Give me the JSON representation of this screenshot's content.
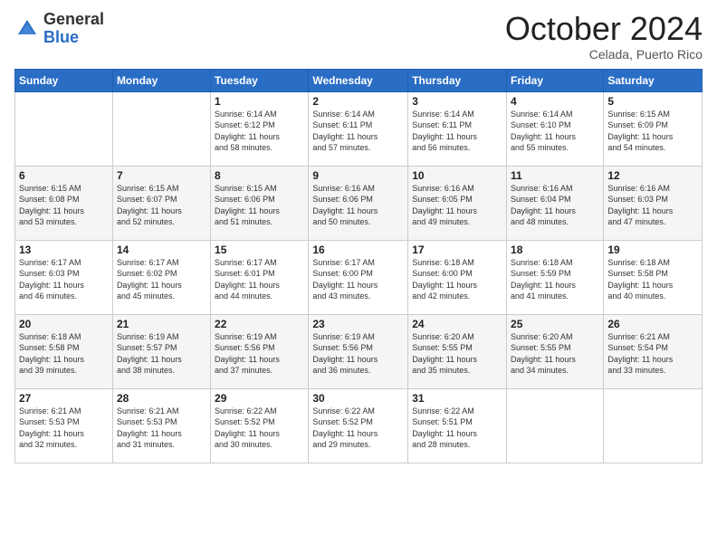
{
  "logo": {
    "general": "General",
    "blue": "Blue"
  },
  "header": {
    "month": "October 2024",
    "location": "Celada, Puerto Rico"
  },
  "weekdays": [
    "Sunday",
    "Monday",
    "Tuesday",
    "Wednesday",
    "Thursday",
    "Friday",
    "Saturday"
  ],
  "weeks": [
    [
      {
        "day": "",
        "info": ""
      },
      {
        "day": "",
        "info": ""
      },
      {
        "day": "1",
        "info": "Sunrise: 6:14 AM\nSunset: 6:12 PM\nDaylight: 11 hours\nand 58 minutes."
      },
      {
        "day": "2",
        "info": "Sunrise: 6:14 AM\nSunset: 6:11 PM\nDaylight: 11 hours\nand 57 minutes."
      },
      {
        "day": "3",
        "info": "Sunrise: 6:14 AM\nSunset: 6:11 PM\nDaylight: 11 hours\nand 56 minutes."
      },
      {
        "day": "4",
        "info": "Sunrise: 6:14 AM\nSunset: 6:10 PM\nDaylight: 11 hours\nand 55 minutes."
      },
      {
        "day": "5",
        "info": "Sunrise: 6:15 AM\nSunset: 6:09 PM\nDaylight: 11 hours\nand 54 minutes."
      }
    ],
    [
      {
        "day": "6",
        "info": "Sunrise: 6:15 AM\nSunset: 6:08 PM\nDaylight: 11 hours\nand 53 minutes."
      },
      {
        "day": "7",
        "info": "Sunrise: 6:15 AM\nSunset: 6:07 PM\nDaylight: 11 hours\nand 52 minutes."
      },
      {
        "day": "8",
        "info": "Sunrise: 6:15 AM\nSunset: 6:06 PM\nDaylight: 11 hours\nand 51 minutes."
      },
      {
        "day": "9",
        "info": "Sunrise: 6:16 AM\nSunset: 6:06 PM\nDaylight: 11 hours\nand 50 minutes."
      },
      {
        "day": "10",
        "info": "Sunrise: 6:16 AM\nSunset: 6:05 PM\nDaylight: 11 hours\nand 49 minutes."
      },
      {
        "day": "11",
        "info": "Sunrise: 6:16 AM\nSunset: 6:04 PM\nDaylight: 11 hours\nand 48 minutes."
      },
      {
        "day": "12",
        "info": "Sunrise: 6:16 AM\nSunset: 6:03 PM\nDaylight: 11 hours\nand 47 minutes."
      }
    ],
    [
      {
        "day": "13",
        "info": "Sunrise: 6:17 AM\nSunset: 6:03 PM\nDaylight: 11 hours\nand 46 minutes."
      },
      {
        "day": "14",
        "info": "Sunrise: 6:17 AM\nSunset: 6:02 PM\nDaylight: 11 hours\nand 45 minutes."
      },
      {
        "day": "15",
        "info": "Sunrise: 6:17 AM\nSunset: 6:01 PM\nDaylight: 11 hours\nand 44 minutes."
      },
      {
        "day": "16",
        "info": "Sunrise: 6:17 AM\nSunset: 6:00 PM\nDaylight: 11 hours\nand 43 minutes."
      },
      {
        "day": "17",
        "info": "Sunrise: 6:18 AM\nSunset: 6:00 PM\nDaylight: 11 hours\nand 42 minutes."
      },
      {
        "day": "18",
        "info": "Sunrise: 6:18 AM\nSunset: 5:59 PM\nDaylight: 11 hours\nand 41 minutes."
      },
      {
        "day": "19",
        "info": "Sunrise: 6:18 AM\nSunset: 5:58 PM\nDaylight: 11 hours\nand 40 minutes."
      }
    ],
    [
      {
        "day": "20",
        "info": "Sunrise: 6:18 AM\nSunset: 5:58 PM\nDaylight: 11 hours\nand 39 minutes."
      },
      {
        "day": "21",
        "info": "Sunrise: 6:19 AM\nSunset: 5:57 PM\nDaylight: 11 hours\nand 38 minutes."
      },
      {
        "day": "22",
        "info": "Sunrise: 6:19 AM\nSunset: 5:56 PM\nDaylight: 11 hours\nand 37 minutes."
      },
      {
        "day": "23",
        "info": "Sunrise: 6:19 AM\nSunset: 5:56 PM\nDaylight: 11 hours\nand 36 minutes."
      },
      {
        "day": "24",
        "info": "Sunrise: 6:20 AM\nSunset: 5:55 PM\nDaylight: 11 hours\nand 35 minutes."
      },
      {
        "day": "25",
        "info": "Sunrise: 6:20 AM\nSunset: 5:55 PM\nDaylight: 11 hours\nand 34 minutes."
      },
      {
        "day": "26",
        "info": "Sunrise: 6:21 AM\nSunset: 5:54 PM\nDaylight: 11 hours\nand 33 minutes."
      }
    ],
    [
      {
        "day": "27",
        "info": "Sunrise: 6:21 AM\nSunset: 5:53 PM\nDaylight: 11 hours\nand 32 minutes."
      },
      {
        "day": "28",
        "info": "Sunrise: 6:21 AM\nSunset: 5:53 PM\nDaylight: 11 hours\nand 31 minutes."
      },
      {
        "day": "29",
        "info": "Sunrise: 6:22 AM\nSunset: 5:52 PM\nDaylight: 11 hours\nand 30 minutes."
      },
      {
        "day": "30",
        "info": "Sunrise: 6:22 AM\nSunset: 5:52 PM\nDaylight: 11 hours\nand 29 minutes."
      },
      {
        "day": "31",
        "info": "Sunrise: 6:22 AM\nSunset: 5:51 PM\nDaylight: 11 hours\nand 28 minutes."
      },
      {
        "day": "",
        "info": ""
      },
      {
        "day": "",
        "info": ""
      }
    ]
  ]
}
